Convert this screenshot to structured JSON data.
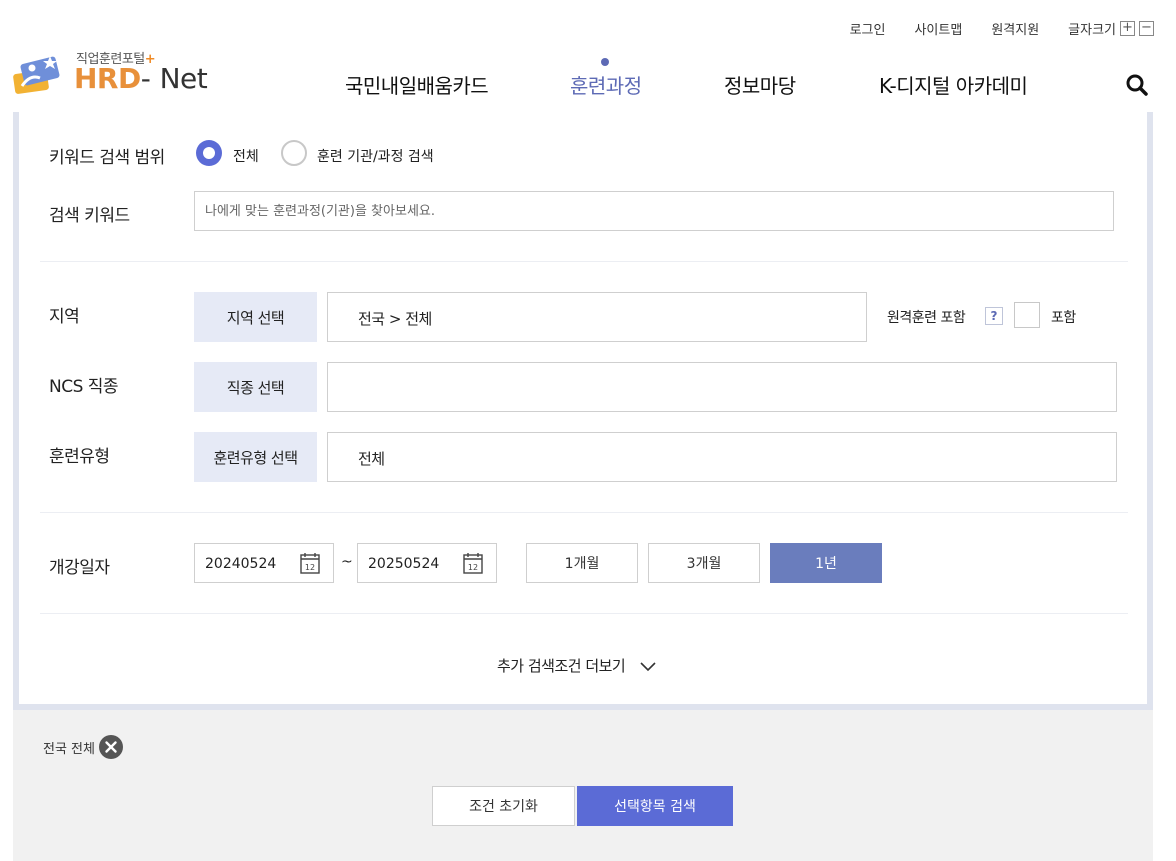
{
  "utility_nav": {
    "login": "로그인",
    "sitemap": "사이트맵",
    "remote_support": "원격지원",
    "font_size": "글자크기",
    "font_increase": "+",
    "font_decrease": "−"
  },
  "logo": {
    "subtitle": "직업훈련포털",
    "subtitle_plus": "+",
    "brand_hrd": "HRD",
    "brand_dash": "-",
    "brand_net": "Net"
  },
  "main_nav": {
    "items": [
      {
        "label": "국민내일배움카드",
        "active": false
      },
      {
        "label": "훈련과정",
        "active": true
      },
      {
        "label": "정보마당",
        "active": false
      },
      {
        "label": "K-디지털 아카데미",
        "active": false
      }
    ]
  },
  "search_form": {
    "keyword_scope": {
      "label": "키워드 검색 범위",
      "options": [
        {
          "label": "전체",
          "selected": true
        },
        {
          "label": "훈련 기관/과정 검색",
          "selected": false
        }
      ]
    },
    "keyword": {
      "label": "검색 키워드",
      "value": "",
      "placeholder": "나에게 맞는 훈련과정(기관)을 찾아보세요."
    },
    "region": {
      "label": "지역",
      "button": "지역 선택",
      "value": "전국 > 전체",
      "remote_label": "원격훈련 포함",
      "help": "?",
      "include_label": "포함",
      "include_checked": false
    },
    "ncs": {
      "label": "NCS 직종",
      "button": "직종 선택",
      "value": ""
    },
    "training_type": {
      "label": "훈련유형",
      "button": "훈련유형 선택",
      "value": "전체"
    },
    "start_date": {
      "label": "개강일자",
      "from": "20240524",
      "separator": "~",
      "to": "20250524",
      "calendar_day": "12",
      "periods": [
        {
          "label": "1개월",
          "active": false
        },
        {
          "label": "3개월",
          "active": false
        },
        {
          "label": "1년",
          "active": true
        }
      ]
    },
    "more_conditions": "추가 검색조건 더보기"
  },
  "selected_filters": {
    "tags": [
      {
        "label": "전국 전체"
      }
    ]
  },
  "actions": {
    "reset": "조건 초기화",
    "search": "선택항목 검색"
  },
  "colors": {
    "accent": "#5b6bd6",
    "nav_active": "#5d6ab5",
    "period_active": "#6a7dbd",
    "select_button_bg": "#e6eaf6",
    "logo_orange": "#e8903a"
  }
}
